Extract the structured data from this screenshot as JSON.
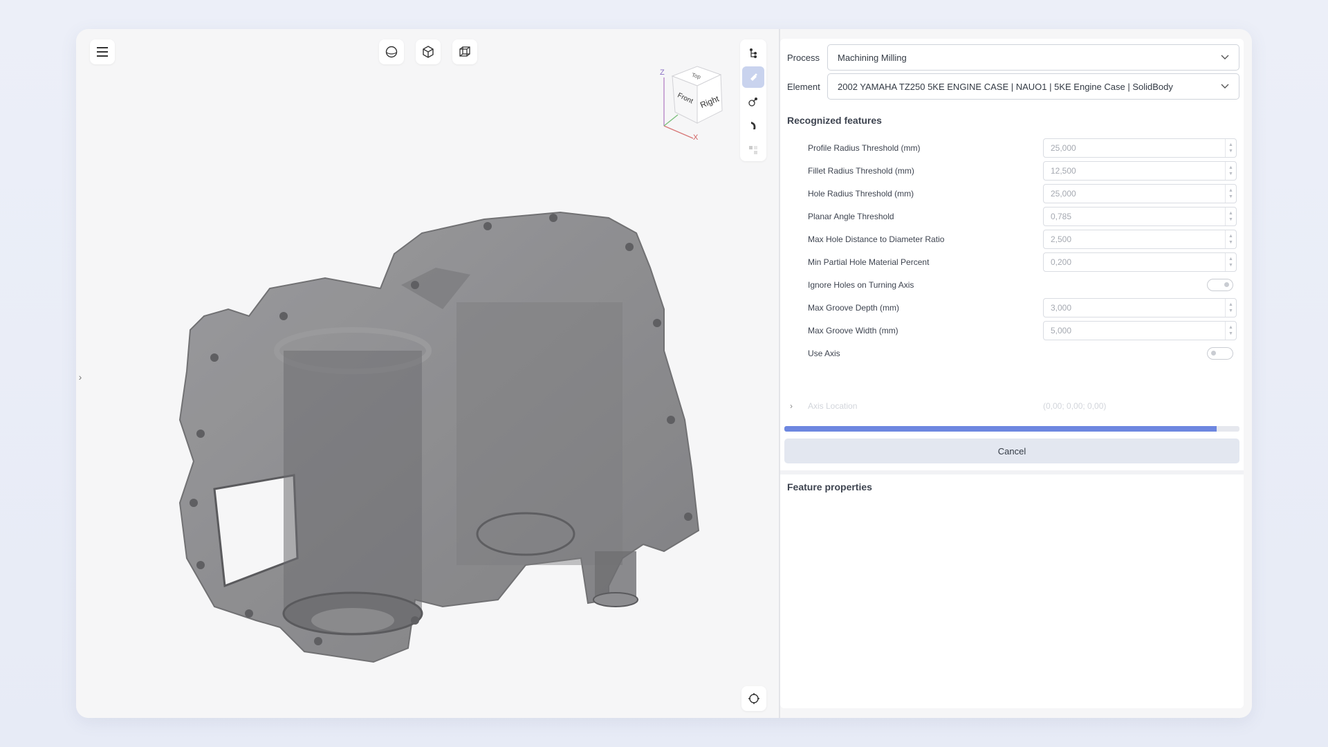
{
  "panel": {
    "process_label": "Process",
    "process_value": "Machining Milling",
    "element_label": "Element",
    "element_value": "2002 YAMAHA TZ250 5KE ENGINE CASE | NAUO1 | 5KE Engine Case | SolidBody",
    "recognized_title": "Recognized features",
    "params": [
      {
        "label": "Profile Radius Threshold (mm)",
        "value": "25,000"
      },
      {
        "label": "Fillet Radius Threshold (mm)",
        "value": "12,500"
      },
      {
        "label": "Hole Radius Threshold (mm)",
        "value": "25,000"
      },
      {
        "label": "Planar Angle Threshold",
        "value": "0,785"
      },
      {
        "label": "Max Hole Distance to Diameter Ratio",
        "value": "2,500"
      },
      {
        "label": "Min Partial Hole Material Percent",
        "value": "0,200"
      }
    ],
    "ignore_holes_label": "Ignore Holes on Turning Axis",
    "ignore_holes_on": true,
    "groove_params": [
      {
        "label": "Max Groove Depth (mm)",
        "value": "3,000"
      },
      {
        "label": "Max Groove Width (mm)",
        "value": "5,000"
      }
    ],
    "use_axis_label": "Use Axis",
    "use_axis_on": false,
    "axis_location_label": "Axis Location",
    "axis_location_value": "(0,00; 0,00; 0,00)",
    "progress_fraction": 0.95,
    "cancel_label": "Cancel",
    "feature_properties_title": "Feature properties"
  },
  "viewcube": {
    "top": "Top",
    "front": "Front",
    "right": "Right",
    "axis_z": "Z",
    "axis_x": "X"
  },
  "icons": {
    "menu": "hamburger-icon",
    "shaded": "sphere-icon",
    "solid": "cube-icon",
    "wire": "wireframe-cube-icon",
    "tree": "tree-icon",
    "features": "feature-icon",
    "recenter": "recenter-icon"
  },
  "colors": {
    "accent": "#6d87e0",
    "active_tool": "#c9d3ee",
    "model_gray": "#7a7a7d"
  }
}
